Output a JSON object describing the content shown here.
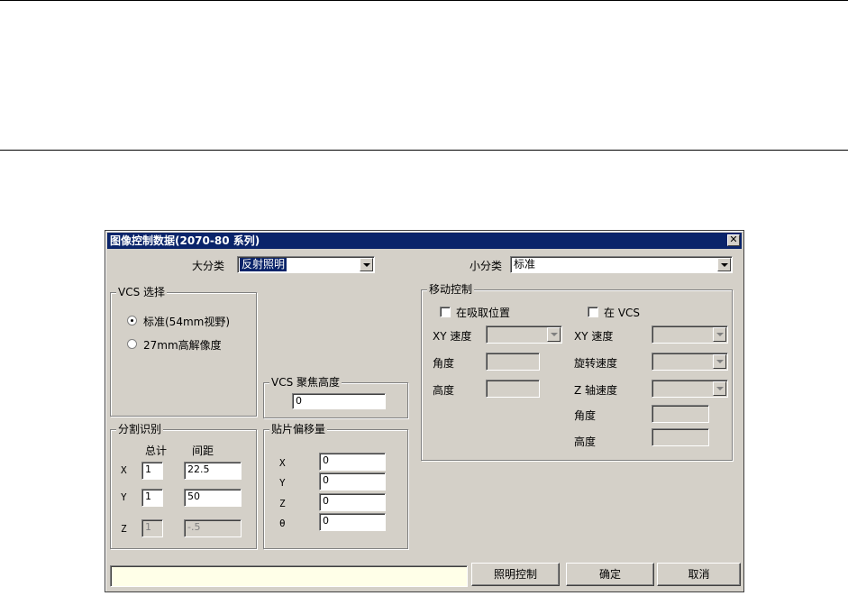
{
  "dialog": {
    "title": "图像控制数据(2070-80 系列)",
    "close_glyph": "✕"
  },
  "category": {
    "major_label": "大分类",
    "major_value": "反射照明",
    "minor_label": "小分类",
    "minor_value": "标准"
  },
  "vcs_select": {
    "title": "VCS 选择",
    "option_standard": "标准(54mm视野)",
    "option_27mm": "27mm高解像度",
    "selected": "standard"
  },
  "vcs_focus": {
    "title": "VCS 聚焦高度",
    "value": "0"
  },
  "division": {
    "title": "分割识别",
    "col_total": "总计",
    "col_spacing": "间距",
    "rows": [
      {
        "axis": "X",
        "total": "1",
        "spacing": "22.5"
      },
      {
        "axis": "Y",
        "total": "1",
        "spacing": "50"
      },
      {
        "axis": "Z",
        "total": "1",
        "spacing": "-.5"
      }
    ]
  },
  "offset": {
    "title": "贴片偏移量",
    "rows": [
      {
        "axis": "X",
        "value": "0"
      },
      {
        "axis": "Y",
        "value": "0"
      },
      {
        "axis": "Z",
        "value": "0"
      },
      {
        "axis": "θ",
        "value": "0"
      }
    ]
  },
  "motion": {
    "title": "移动控制",
    "pick_position_label": "在吸取位置",
    "in_vcs_label": "在 VCS",
    "left": {
      "xy_speed_label": "XY 速度",
      "angle_label": "角度",
      "height_label": "高度"
    },
    "right": {
      "xy_speed_label": "XY 速度",
      "rotation_speed_label": "旋转速度",
      "z_speed_label": "Z 轴速度",
      "angle_label": "角度",
      "height_label": "高度"
    }
  },
  "buttons": {
    "lighting": "照明控制",
    "ok": "确定",
    "cancel": "取消"
  },
  "status_text": ""
}
